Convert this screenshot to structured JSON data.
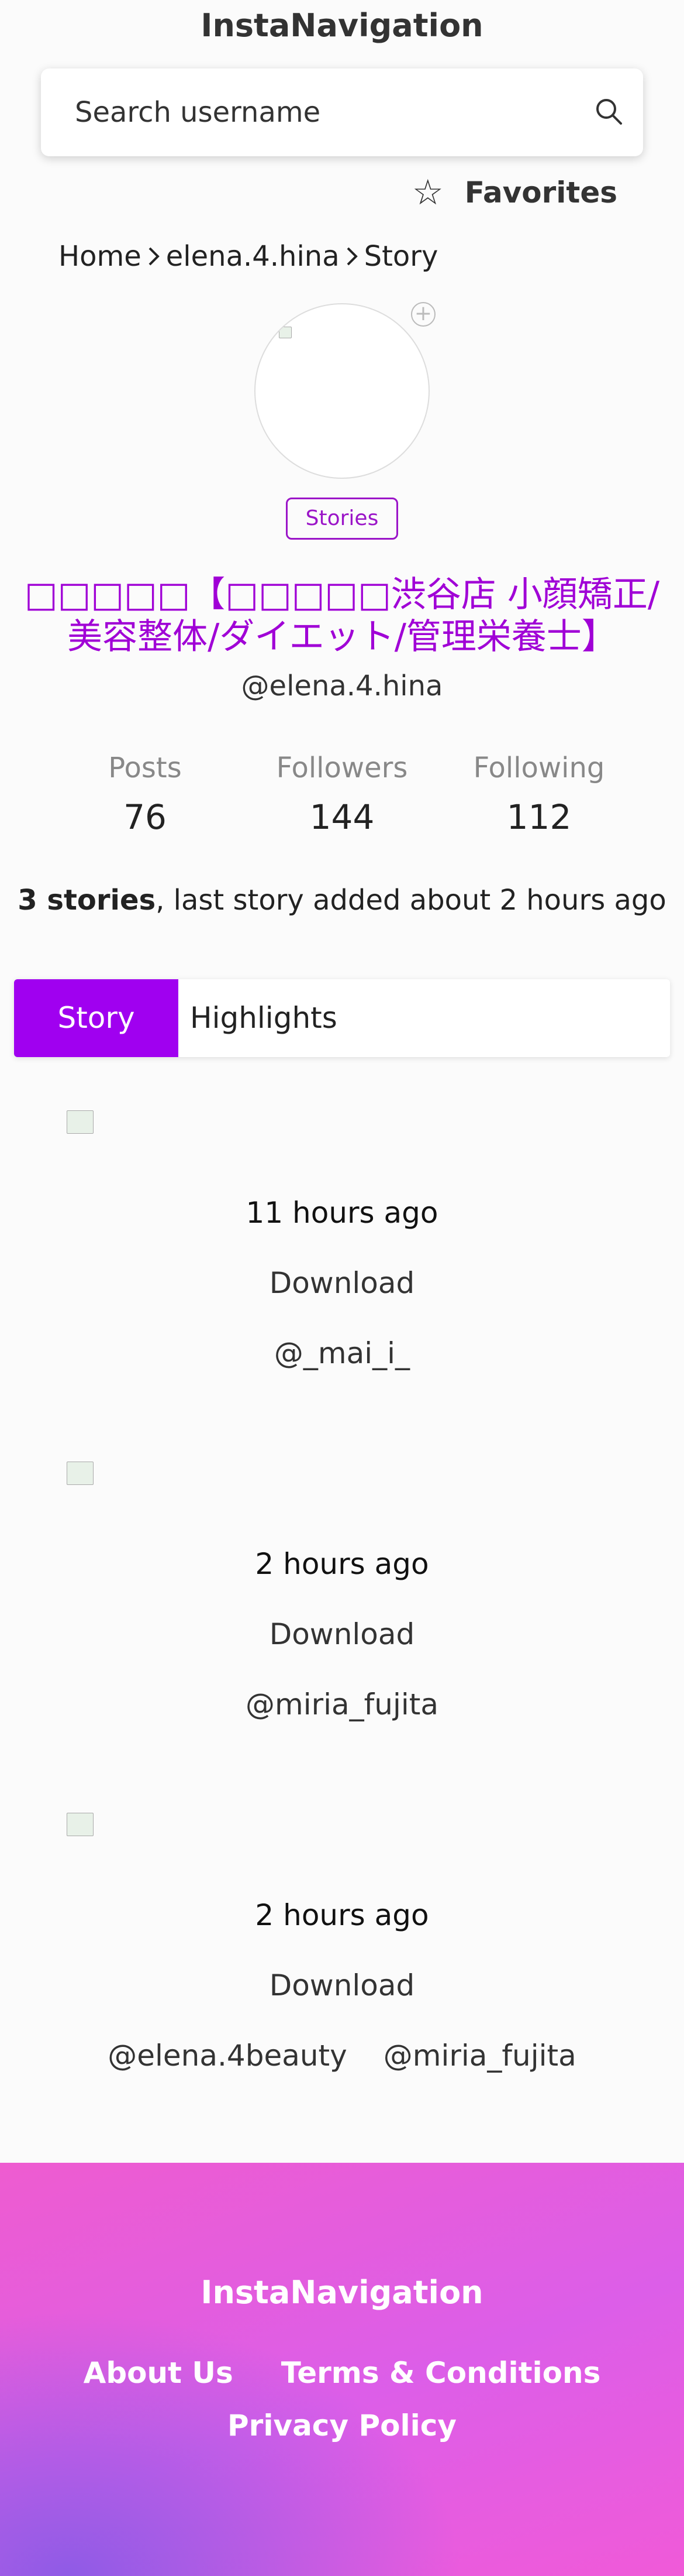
{
  "header": {
    "site_title": "InstaNavigation",
    "search_placeholder": "Search username",
    "favorites_label": "Favorites"
  },
  "breadcrumb": [
    "Home",
    "elena.4.hina",
    "Story"
  ],
  "profile": {
    "stories_badge": "Stories",
    "display_name": "□□□□□【□□□□□渋谷店 小顔矯正/美容整体/ダイエット/管理栄養士】",
    "username": "@elena.4.hina"
  },
  "stats": [
    {
      "label": "Posts",
      "value": "76"
    },
    {
      "label": "Followers",
      "value": "144"
    },
    {
      "label": "Following",
      "value": "112"
    }
  ],
  "summary": {
    "count": "3 stories",
    "rest": ", last story added about 2 hours ago"
  },
  "tabs": {
    "active": "Story",
    "inactive": "Highlights"
  },
  "stories": [
    {
      "time": "11 hours ago",
      "download": "Download",
      "mentions": [
        "@_mai_i_"
      ]
    },
    {
      "time": "2 hours ago",
      "download": "Download",
      "mentions": [
        "@miria_fujita"
      ]
    },
    {
      "time": "2 hours ago",
      "download": "Download",
      "mentions": [
        "@elena.4beauty",
        "@miria_fujita"
      ]
    }
  ],
  "footer": {
    "brand": "InstaNavigation",
    "about": "About Us",
    "terms": "Terms & Conditions",
    "privacy": "Privacy Policy"
  },
  "colors": {
    "accent": "#a000f0",
    "name_color": "#a000d6",
    "footer_pink": "#ee5cd0",
    "footer_purple": "#8f5be6"
  }
}
